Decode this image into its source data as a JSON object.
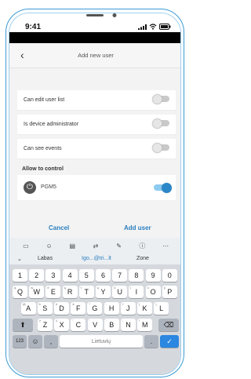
{
  "status": {
    "time": "9:41"
  },
  "header": {
    "back_icon": "chevron-left-icon",
    "title": "Add new user"
  },
  "permissions": [
    {
      "label": "Can edit user list",
      "on": false
    },
    {
      "label": "Is device administrator",
      "on": false
    },
    {
      "label": "Can see events",
      "on": false
    }
  ],
  "control": {
    "section_title": "Allow to control",
    "device": {
      "label": "PGM5",
      "on": true
    }
  },
  "actions": {
    "cancel": "Cancel",
    "add": "Add user"
  },
  "keyboard": {
    "suggestions": [
      "Labas",
      "Igo...@tri...lt",
      "Zone"
    ],
    "row1": [
      "1",
      "2",
      "3",
      "4",
      "5",
      "6",
      "7",
      "8",
      "9",
      "0"
    ],
    "row2": [
      "Q",
      "W",
      "E",
      "R",
      "T",
      "Y",
      "U",
      "I",
      "O",
      "P"
    ],
    "row3": [
      "A",
      "S",
      "D",
      "F",
      "G",
      "H",
      "J",
      "K",
      "L"
    ],
    "row4": [
      "Z",
      "X",
      "C",
      "V",
      "B",
      "N",
      "M"
    ],
    "row2_sub": [
      "q",
      "w",
      "ė",
      "ą",
      "t",
      "ų",
      "ū",
      "į",
      "o",
      "p"
    ],
    "row3_sub": [
      "@",
      "š",
      "#",
      "&",
      "*",
      "-",
      "+",
      "(",
      ")"
    ],
    "row4_sub": [
      "ž",
      "č",
      "\"",
      "'",
      ":",
      ";",
      "!"
    ],
    "space": "Lietuvių",
    "num_key": "123",
    "comma": ","
  },
  "colors": {
    "accent": "#2a7fc0",
    "frame": "#3a9bd5"
  }
}
